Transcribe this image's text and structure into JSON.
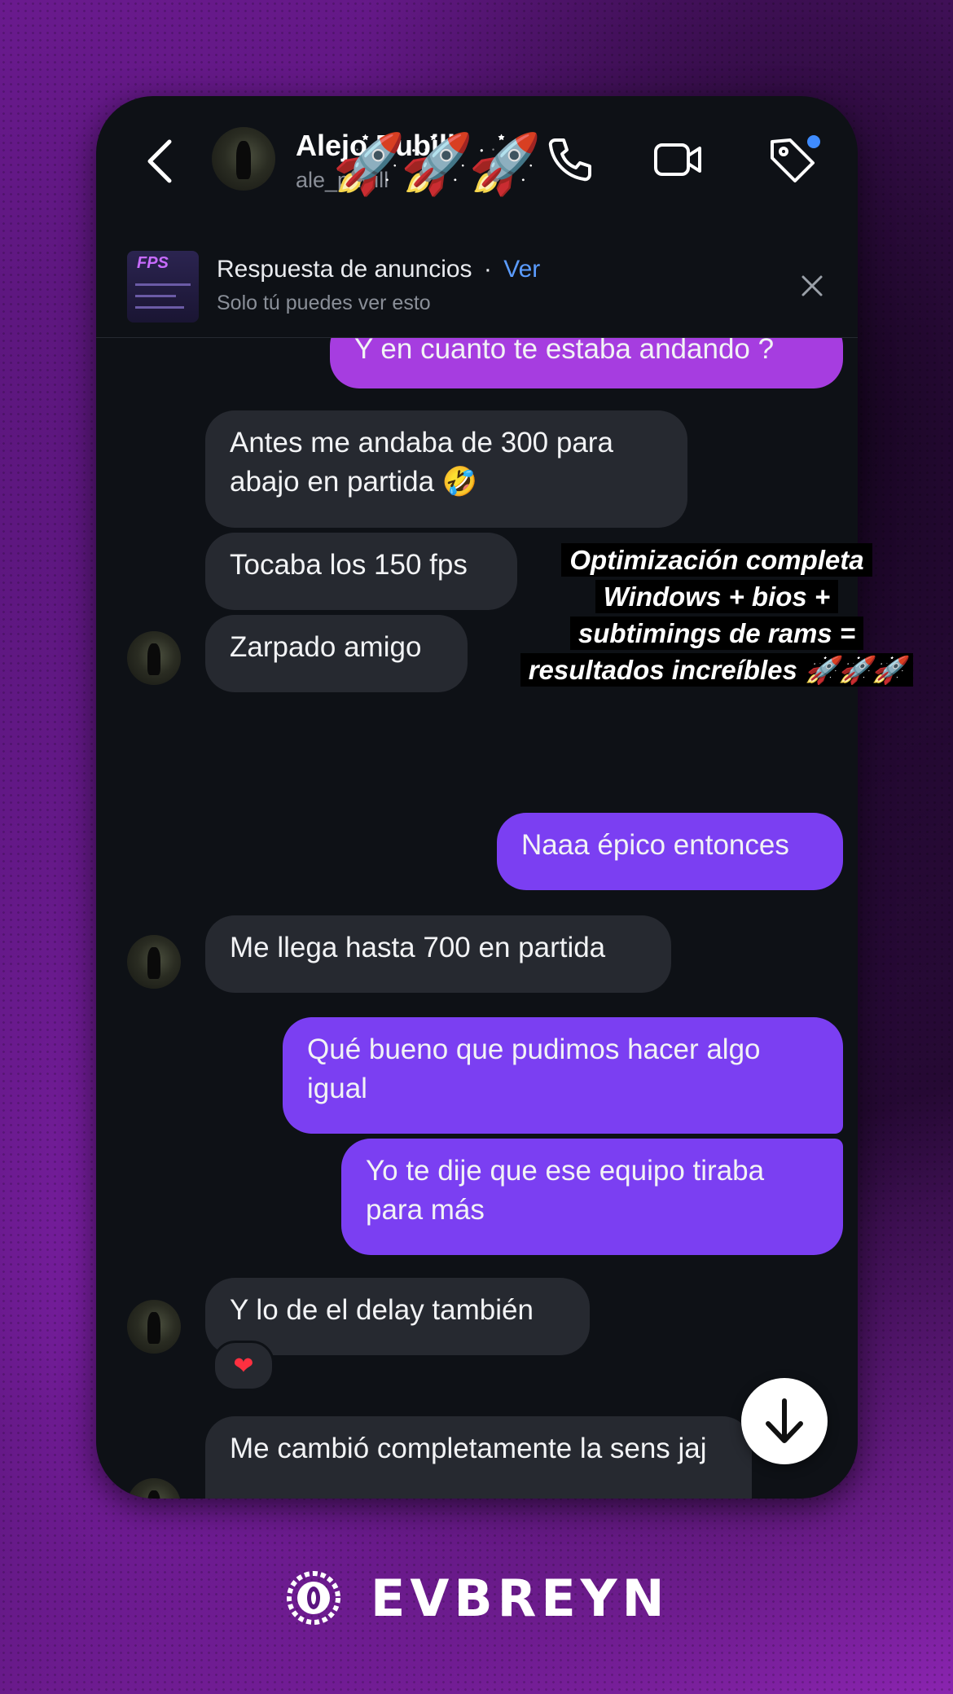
{
  "header": {
    "name": "Alejo Pubill",
    "username": "ale_pubill",
    "rockets": "🚀🚀🚀"
  },
  "ad_bar": {
    "thumb_title": "FPS",
    "title": "Respuesta de anuncios",
    "separator": "·",
    "view_link": "Ver",
    "subtitle": "Solo tú puedes ver esto"
  },
  "messages": [
    {
      "from": "me",
      "text": "Y en cuanto te estaba andando ?"
    },
    {
      "from": "them",
      "text": "Antes me andaba de 300 para abajo en partida 🤣"
    },
    {
      "from": "them",
      "text": "Tocaba los 150 fps"
    },
    {
      "from": "them",
      "text": "Zarpado amigo"
    },
    {
      "from": "me",
      "text": "Naaa épico entonces"
    },
    {
      "from": "them",
      "text": "Me llega hasta 700 en partida"
    },
    {
      "from": "me",
      "text": "Qué bueno que pudimos hacer algo igual"
    },
    {
      "from": "me",
      "text": "Yo te dije que ese equipo tiraba para más"
    },
    {
      "from": "them",
      "text": "Y lo de el delay también",
      "reaction": "❤"
    },
    {
      "from": "them",
      "text": "Me cambió completamente la sens jaj",
      "reaction": "❤"
    }
  ],
  "overlay": {
    "lines": [
      "Optimización completa",
      "Windows + bios +",
      "subtimings de rams =",
      "resultados increíbles 🚀🚀🚀"
    ]
  },
  "brand": {
    "name": "EVBREYN"
  },
  "colors": {
    "outgoing_bubble": "#7b3ff2",
    "incoming_bubble": "#262930",
    "background": "#4a1268",
    "link": "#5b9cff"
  }
}
